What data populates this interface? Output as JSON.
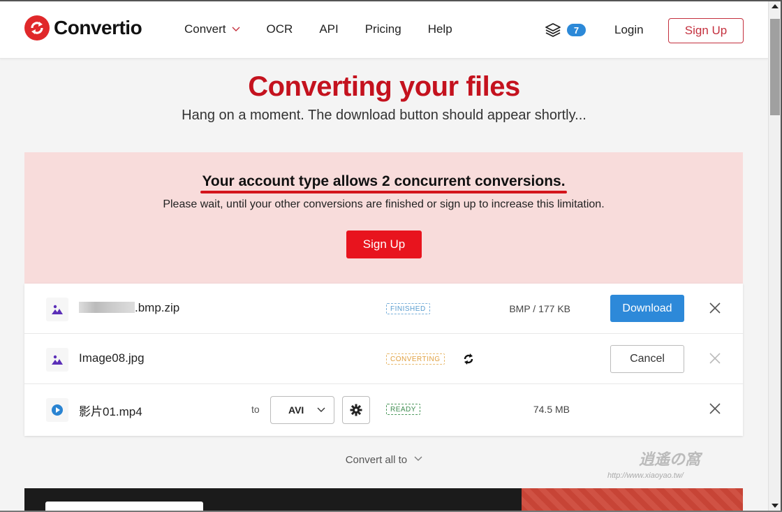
{
  "header": {
    "logo_text": "Convertio",
    "nav": [
      {
        "label": "Convert",
        "has_dropdown": true
      },
      {
        "label": "OCR"
      },
      {
        "label": "API"
      },
      {
        "label": "Pricing"
      },
      {
        "label": "Help"
      }
    ],
    "stack_count": "7",
    "login_label": "Login",
    "signup_label": "Sign Up"
  },
  "main": {
    "title": "Converting your files",
    "subtitle": "Hang on a moment. The download button should appear shortly..."
  },
  "alert": {
    "heading": "Your account type allows 2 concurrent conversions.",
    "text": "Please wait, until your other conversions are finished or sign up to increase this limitation.",
    "button_label": "Sign Up"
  },
  "files": [
    {
      "name_suffix": ".bmp.zip",
      "icon": "image-icon",
      "status": "FINISHED",
      "size": "BMP / 177 KB",
      "action": "Download"
    },
    {
      "name": "Image08.jpg",
      "icon": "image-icon",
      "status": "CONVERTING",
      "action": "Cancel"
    },
    {
      "name": "影片01.mp4",
      "icon": "video-icon",
      "to_label": "to",
      "format": "AVI",
      "status": "READY",
      "size": "74.5 MB"
    }
  ],
  "convert_all_label": "Convert all to",
  "watermark": {
    "logo": "逍遙の窩",
    "url": "http://www.xiaoyao.tw/"
  },
  "colors": {
    "brand": "#e0282a",
    "title_red": "#c4121e",
    "alert_bg": "#f8dcdb",
    "primary_blue": "#2d89d9"
  }
}
